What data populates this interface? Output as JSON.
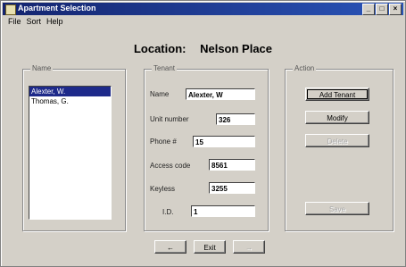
{
  "window": {
    "title": "Apartment Selection"
  },
  "window_buttons": {
    "minimize": "_",
    "maximize": "□",
    "close": "×"
  },
  "menu": [
    "File",
    "Sort",
    "Help"
  ],
  "location": {
    "label": "Location:",
    "value": "Nelson Place"
  },
  "name_group": {
    "legend": "Name",
    "items": [
      {
        "label": "Alexter, W.",
        "selected": true
      },
      {
        "label": "Thomas, G.",
        "selected": false
      }
    ]
  },
  "tenant_group": {
    "legend": "Tenant",
    "fields": {
      "name": {
        "label": "Name",
        "value": "Alexter, W"
      },
      "unit": {
        "label": "Unit number",
        "value": "326"
      },
      "phone": {
        "label": "Phone #",
        "value": "15"
      },
      "access": {
        "label": "Access code",
        "value": "8561"
      },
      "keyless": {
        "label": "Keyless",
        "value": "3255"
      },
      "id": {
        "label": "I.D.",
        "value": "1"
      }
    }
  },
  "action_group": {
    "legend": "Action",
    "add": "Add Tenant",
    "modify": "Modify",
    "delete": "Delete",
    "save": "Save"
  },
  "bottom": {
    "back": "←",
    "exit": "Exit",
    "forward": "→"
  }
}
